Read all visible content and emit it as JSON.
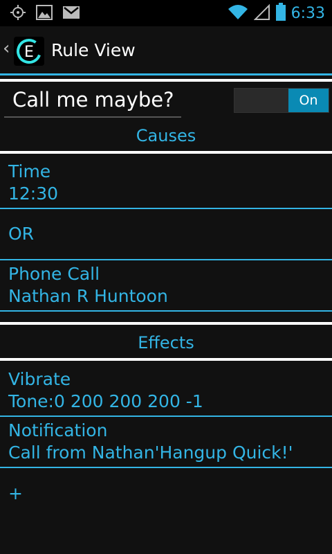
{
  "status_bar": {
    "time": "6:33",
    "icons": [
      "gps-icon",
      "image-icon",
      "gmail-icon",
      "wifi-icon",
      "signal-icon",
      "battery-icon"
    ]
  },
  "action_bar": {
    "title": "Rule View",
    "app_icon_letter": "E"
  },
  "rule": {
    "name": "Call me maybe?",
    "toggle_label": "On",
    "enabled": true
  },
  "causes": {
    "header": "Causes",
    "items": [
      {
        "title": "Time",
        "detail": "12:30"
      },
      {
        "title": "OR",
        "detail": ""
      },
      {
        "title": "Phone Call",
        "detail": "Nathan R Huntoon"
      }
    ]
  },
  "effects": {
    "header": "Effects",
    "items": [
      {
        "title": "Vibrate",
        "detail": "Tone:0 200 200 200 -1"
      },
      {
        "title": "Notification",
        "detail": "Call from Nathan'Hangup Quick!'"
      }
    ],
    "add_label": "+"
  },
  "colors": {
    "accent": "#33b5e5",
    "background": "#111111",
    "toggle_on": "#0a8ab4"
  }
}
